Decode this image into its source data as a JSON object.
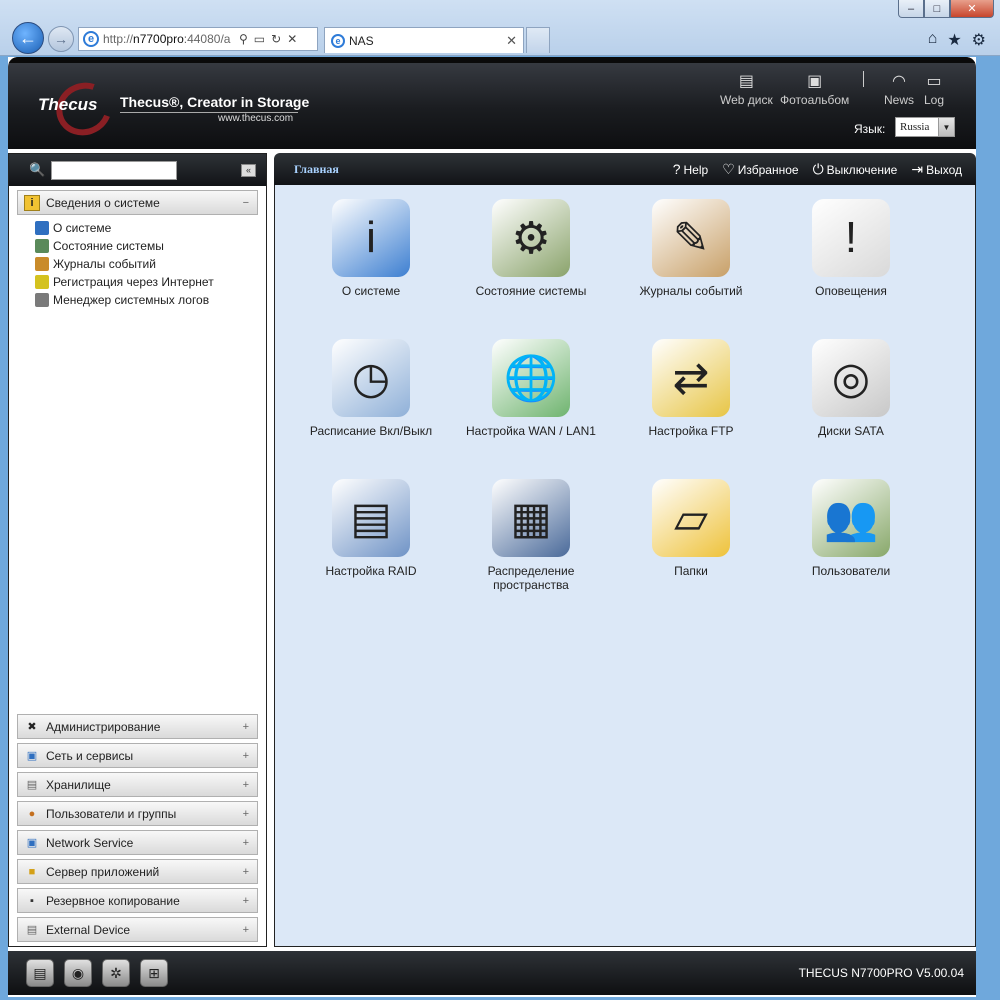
{
  "browser": {
    "address_prefix": "http://",
    "address_host": "n7700pro",
    "address_rest": ":44080/a",
    "tab_title": "NAS",
    "window_controls": [
      "minimize",
      "maximize",
      "close"
    ],
    "tool_icons": [
      "home-icon",
      "star-icon",
      "gear-icon"
    ]
  },
  "header": {
    "logo_text": "Thecus",
    "tagline": "Thecus®, Creator in Storage",
    "url": "www.thecus.com",
    "links": [
      {
        "label": "Web диск",
        "icon": "web-disk-icon"
      },
      {
        "label": "Фотоальбом",
        "icon": "photo-album-icon"
      },
      {
        "label": "News",
        "icon": "rss-icon"
      },
      {
        "label": "Log",
        "icon": "log-icon"
      }
    ],
    "language_label": "Язык:",
    "language_value": "Russia"
  },
  "sidebar": {
    "active_section": {
      "label": "Сведения о системе",
      "toggle": "−"
    },
    "items": [
      {
        "label": "О системе",
        "color": "#2f6fc0"
      },
      {
        "label": "Состояние системы",
        "color": "#5a8a5a"
      },
      {
        "label": "Журналы событий",
        "color": "#c98b2a"
      },
      {
        "label": "Регистрация через Интернет",
        "color": "#d4c21f"
      },
      {
        "label": "Менеджер системных логов",
        "color": "#7a7a7a"
      }
    ],
    "sections": [
      {
        "label": "Администрирование",
        "icon": "tools-icon",
        "toggle": "+"
      },
      {
        "label": "Сеть и сервисы",
        "icon": "network-icon",
        "toggle": "+"
      },
      {
        "label": "Хранилище",
        "icon": "storage-icon",
        "toggle": "+"
      },
      {
        "label": "Пользователи и группы",
        "icon": "users-icon",
        "toggle": "+"
      },
      {
        "label": "Network Service",
        "icon": "network-service-icon",
        "toggle": "+"
      },
      {
        "label": "Сервер приложений",
        "icon": "app-server-icon",
        "toggle": "+"
      },
      {
        "label": "Резервное копирование",
        "icon": "backup-icon",
        "toggle": "+"
      },
      {
        "label": "External Device",
        "icon": "external-device-icon",
        "toggle": "+"
      }
    ]
  },
  "main": {
    "title": "Главная",
    "actions": [
      {
        "label": "Help",
        "icon": "help-icon"
      },
      {
        "label": "Избранное",
        "icon": "favorites-icon"
      },
      {
        "label": "Выключение",
        "icon": "power-icon"
      },
      {
        "label": "Выход",
        "icon": "logout-icon"
      }
    ],
    "tiles": [
      {
        "label": "О системе",
        "icon": "about-system-icon",
        "bg": "#3d7fd1",
        "glyph": "i"
      },
      {
        "label": "Состояние системы",
        "icon": "system-status-icon",
        "bg": "#8aa36b",
        "glyph": "⚙"
      },
      {
        "label": "Журналы событий",
        "icon": "event-log-icon",
        "bg": "#c8a068",
        "glyph": "✎"
      },
      {
        "label": "Оповещения",
        "icon": "notification-icon",
        "bg": "#d9d9d9",
        "glyph": "!"
      },
      {
        "label": "Расписание Вкл/Выкл",
        "icon": "schedule-icon",
        "bg": "#8fb0d8",
        "glyph": "◷"
      },
      {
        "label": "Настройка WAN / LAN1",
        "icon": "wan-lan-icon",
        "bg": "#6fb46f",
        "glyph": "🌐"
      },
      {
        "label": "Настройка FTP",
        "icon": "ftp-icon",
        "bg": "#e7c545",
        "glyph": "⇄"
      },
      {
        "label": "Диски SATA",
        "icon": "sata-disks-icon",
        "bg": "#c8c8c8",
        "glyph": "◎"
      },
      {
        "label": "Настройка RAID",
        "icon": "raid-icon",
        "bg": "#6f93c6",
        "glyph": "▤"
      },
      {
        "label": "Распределение пространства",
        "icon": "space-allocation-icon",
        "bg": "#4a6a9a",
        "glyph": "▦"
      },
      {
        "label": "Папки",
        "icon": "folders-icon",
        "bg": "#eec23a",
        "glyph": "▱"
      },
      {
        "label": "Пользователи",
        "icon": "users-tile-icon",
        "bg": "#88a86a",
        "glyph": "👥"
      }
    ]
  },
  "footer": {
    "buttons": [
      "server-icon",
      "disk-icon",
      "fan-icon",
      "network-tree-icon"
    ],
    "version": "THECUS N7700PRO V5.00.04"
  }
}
